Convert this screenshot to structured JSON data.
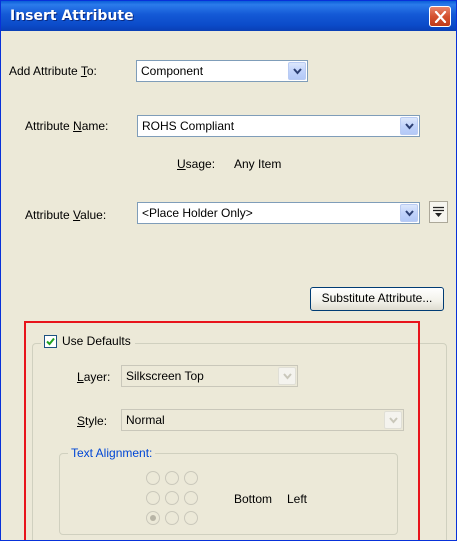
{
  "window": {
    "title": "Insert Attribute",
    "close_icon": "close-icon"
  },
  "add_to": {
    "label_prefix": "Add Attribute ",
    "label_mnemonic": "T",
    "label_suffix": "o:",
    "value": "Component"
  },
  "attr_name": {
    "label_prefix": "Attribute ",
    "label_mnemonic": "N",
    "label_suffix": "ame:",
    "value": "ROHS Compliant"
  },
  "usage": {
    "label_mnemonic": "U",
    "label_suffix": "sage:",
    "value": "Any Item"
  },
  "attr_value": {
    "label_prefix": "Attribute ",
    "label_mnemonic": "V",
    "label_suffix": "alue:",
    "value": "<Place Holder Only>",
    "side_icon": "list-options-icon"
  },
  "substitute_button": {
    "label": "Substitute Attribute..."
  },
  "use_defaults": {
    "label": "Use Defaults",
    "checked": true
  },
  "layer": {
    "label_mnemonic": "L",
    "label_suffix": "ayer:",
    "value": "Silkscreen Top"
  },
  "style": {
    "label_mnemonic": "S",
    "label_suffix": "tyle:",
    "value": "Normal"
  },
  "text_alignment": {
    "legend": "Text Alignment:",
    "selected_vertical": "Bottom",
    "selected_horizontal": "Left"
  },
  "colors": {
    "title_bar": "#0A5FD8",
    "dialog_bg": "#ECE9D8",
    "highlight_border": "#E8141B",
    "group_legend": "#0046D5"
  }
}
